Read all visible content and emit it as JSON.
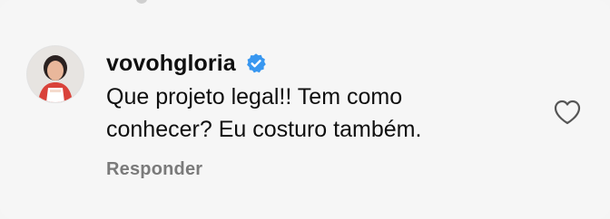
{
  "comment": {
    "username": "vovohgloria",
    "verified": true,
    "text": "Que projeto legal!! Tem como\nconhecer? Eu costuro também.",
    "reply_label": "Responder",
    "like_icon": "heart-outline-icon",
    "verified_icon": "verified-badge-icon"
  },
  "colors": {
    "background": "#f6f6f6",
    "verified_blue": "#3897f0",
    "secondary_text": "#7a7a7a",
    "primary_text": "#0f0f0f"
  }
}
